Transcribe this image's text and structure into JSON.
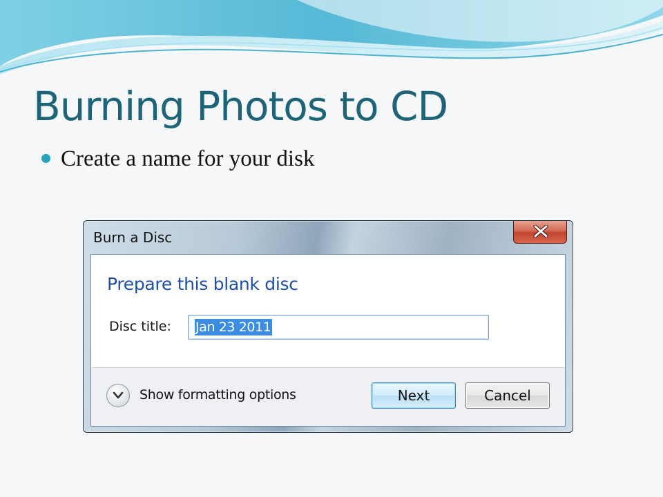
{
  "slide": {
    "title": "Burning Photos to CD",
    "bullets": [
      "Create a name for your disk"
    ]
  },
  "dialog": {
    "title": "Burn a Disc",
    "heading": "Prepare this blank disc",
    "disc_title_label": "Disc title:",
    "disc_title_value": "Jan 23 2011",
    "formatting_toggle_label": "Show formatting options",
    "next_label": "Next",
    "cancel_label": "Cancel",
    "close_icon": "close-icon",
    "expand_icon": "chevron-down-icon"
  },
  "colors": {
    "title": "#1e6478",
    "bullet": "#2aa3bd",
    "heading": "#1f50a7",
    "selection": "#3a8de0",
    "close_button": "#c0452f"
  }
}
